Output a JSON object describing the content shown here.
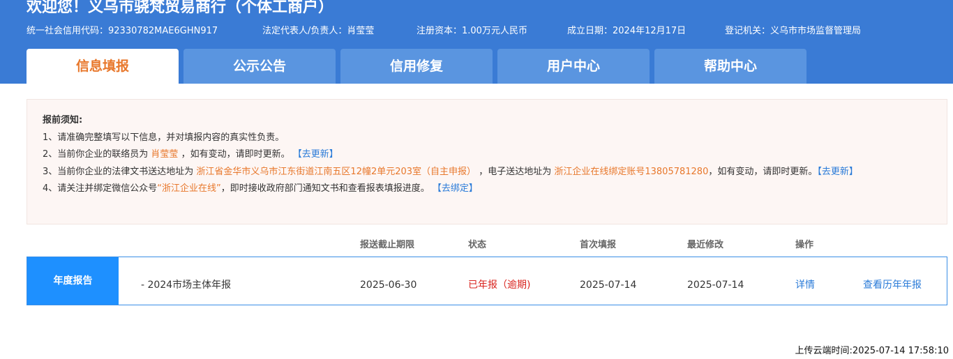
{
  "header": {
    "company_title": "欢迎您！义乌市骁梵贸易商行（个体工商户）",
    "credit_code": "统一社会信用代码：92330782MAE6GHN917",
    "legal_rep": "法定代表人/负责人：肖莹莹",
    "capital": "注册资本：1.00万元人民币",
    "established": "成立日期：2024年12月17日",
    "authority": "登记机关：义乌市市场监督管理局"
  },
  "tabs": [
    {
      "label": "信息填报",
      "active": true
    },
    {
      "label": "公示公告",
      "active": false
    },
    {
      "label": "信用修复",
      "active": false
    },
    {
      "label": "用户中心",
      "active": false
    },
    {
      "label": "帮助中心",
      "active": false
    }
  ],
  "notice": {
    "title": "报前须知:",
    "line1": "1、请准确完整填写以下信息，并对填报内容的真实性负责。",
    "line2_pre": "2、当前你企业的联络员为",
    "line2_name": "肖莹莹",
    "line2_post": "，如有变动，请即时更新。",
    "line2_link": "【去更新】",
    "line3_pre": "3、当前你企业的法律文书送达地址为",
    "line3_addr": "浙江省金华市义乌市江东街道江南五区12幢2单元203室（自主申报）",
    "line3_mid": "，电子送达地址为",
    "line3_eaddr": "浙江企业在线绑定账号13805781280",
    "line3_post": "，如有变动，请即时更新。",
    "line3_link": "【去更新】",
    "line4_pre": "4、请关注并绑定微信公众号",
    "line4_name": "“浙江企业在线”",
    "line4_post": "，即时接收政府部门通知文书和查看报表填报进度。",
    "line4_link": "【去绑定】"
  },
  "table": {
    "headers": {
      "deadline": "报送截止期限",
      "status": "状态",
      "first": "首次填报",
      "modified": "最近修改",
      "action": "操作"
    },
    "row": {
      "label": "年度报告",
      "name": "- 2024市场主体年报",
      "deadline": "2025-06-30",
      "status": "已年报（逾期)",
      "first": "2025-07-14",
      "modified": "2025-07-14",
      "detail": "详情",
      "history": "查看历年年报"
    }
  },
  "footer": {
    "upload_time": "上传云端时间:2025-07-14 17:58:10"
  },
  "colors": {
    "header_bg": "#3a7bd5",
    "tab_bg": "#5a95e0",
    "accent_orange": "#e8782c",
    "link_blue": "#2a7bd8",
    "status_red": "#d9241f",
    "row_label_bg": "#1e90ff"
  }
}
